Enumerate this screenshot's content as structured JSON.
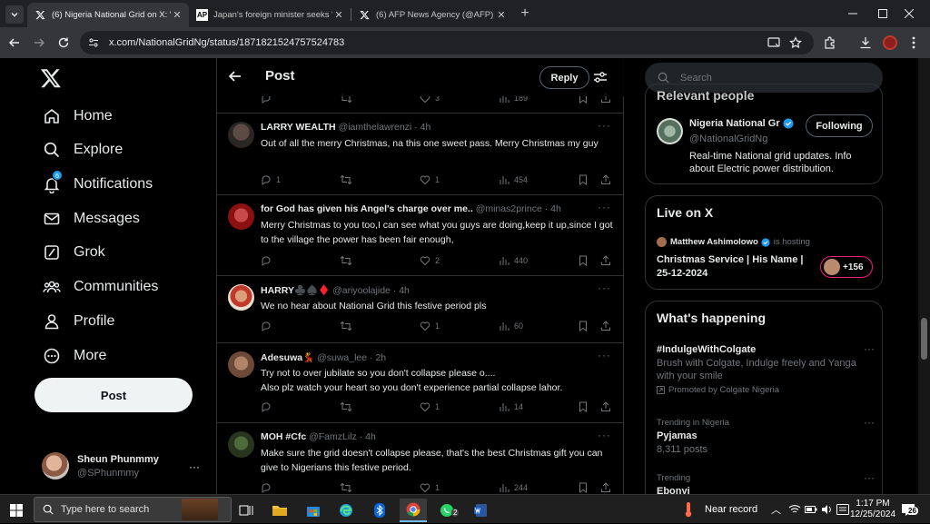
{
  "browser": {
    "tabs": [
      {
        "title": "(6) Nigeria National Grid on X: \"",
        "favicon": "X",
        "active": true
      },
      {
        "title": "Japan's foreign minister seeks \"",
        "favicon": "AP",
        "active": false
      },
      {
        "title": "(6) AFP News Agency (@AFP) /",
        "favicon": "X",
        "active": false
      }
    ],
    "url": "x.com/NationalGridNg/status/1871821524757524783"
  },
  "left_nav": {
    "items": [
      {
        "label": "Home",
        "icon": "home-icon"
      },
      {
        "label": "Explore",
        "icon": "search-icon"
      },
      {
        "label": "Notifications",
        "icon": "bell-icon",
        "badge": "6"
      },
      {
        "label": "Messages",
        "icon": "envelope-icon"
      },
      {
        "label": "Grok",
        "icon": "grok-icon"
      },
      {
        "label": "Communities",
        "icon": "people-icon"
      },
      {
        "label": "Profile",
        "icon": "person-icon"
      },
      {
        "label": "More",
        "icon": "more-circle-icon"
      }
    ],
    "post_button": "Post",
    "account": {
      "name": "Sheun Phunmmy",
      "handle": "@SPhunmmy"
    }
  },
  "main": {
    "title": "Post",
    "reply_button": "Reply",
    "prev_post_counts": {
      "replies": "",
      "reposts": "",
      "likes": "3",
      "views": "189"
    },
    "posts": [
      {
        "name": "LARRY WEALTH",
        "handle": "@iamthelawrenzi",
        "time": "4h",
        "text": "Out of all the merry Christmas, na this one sweet pass. Merry Christmas my guy",
        "replies": "1",
        "reposts": "",
        "likes": "1",
        "views": "454"
      },
      {
        "name": "for God has given his Angel's charge over me..",
        "handle": "@minas2prince",
        "time": "4h",
        "text": "Merry Christmas to you too,I can see what you guys are doing,keep it up,since I got to the village the power has been fair enough,",
        "replies": "",
        "reposts": "",
        "likes": "2",
        "views": "440"
      },
      {
        "name": "HARRY♣️♠️♦️",
        "handle": "@ariyoolajide",
        "time": "4h",
        "text": "We no hear about National Grid this festive period pls",
        "replies": "",
        "reposts": "",
        "likes": "1",
        "views": "60"
      },
      {
        "name": "Adesuwa💃",
        "handle": "@suwa_lee",
        "time": "2h",
        "text": "Try not to over jubilate so you don't collapse please o....\nAlso plz watch your heart so you don't experience partial collapse lahor.",
        "replies": "",
        "reposts": "",
        "likes": "1",
        "views": "14"
      },
      {
        "name": "MOH #Cfc",
        "handle": "@FamzLilz",
        "time": "4h",
        "text": "Make sure the grid doesn't collapse please, that's the best Christmas gift you can give to Nigerians this festive period.",
        "replies": "",
        "reposts": "",
        "likes": "1",
        "views": "244"
      }
    ]
  },
  "right": {
    "search_placeholder": "Search",
    "relevant": {
      "heading": "Relevant people",
      "name": "Nigeria National Gr",
      "handle": "@NationalGridNg",
      "follow_label": "Following",
      "bio": "Real-time National grid updates. Info about Electric power distribution."
    },
    "live": {
      "heading": "Live on X",
      "host": "Matthew Ashimolowo",
      "hosting": "is hosting",
      "title": "Christmas Service | His Name | 25-12-2024",
      "listeners": "+156"
    },
    "happening": {
      "heading": "What's happening",
      "trends": [
        {
          "context": "",
          "name": "#IndulgeWithColgate",
          "desc": "Brush with Colgate, Indulge freely and Yanga with your smile",
          "promo": "Promoted by Colgate Nigeria"
        },
        {
          "context": "Trending in Nigeria",
          "name": "Pyjamas",
          "desc": "8,311 posts",
          "promo": ""
        },
        {
          "context": "Trending",
          "name": "Ebonyi",
          "desc": "",
          "promo": ""
        }
      ]
    }
  },
  "taskbar": {
    "search_placeholder": "Type here to search",
    "weather": "Near record",
    "time": "1:17 PM",
    "date": "12/25/2024",
    "notif_count": "26",
    "whatsapp_count": "2"
  },
  "colors": {
    "accent": "#1d9bf0",
    "background": "#000000",
    "border": "#2f3336",
    "muted": "#71767b"
  }
}
